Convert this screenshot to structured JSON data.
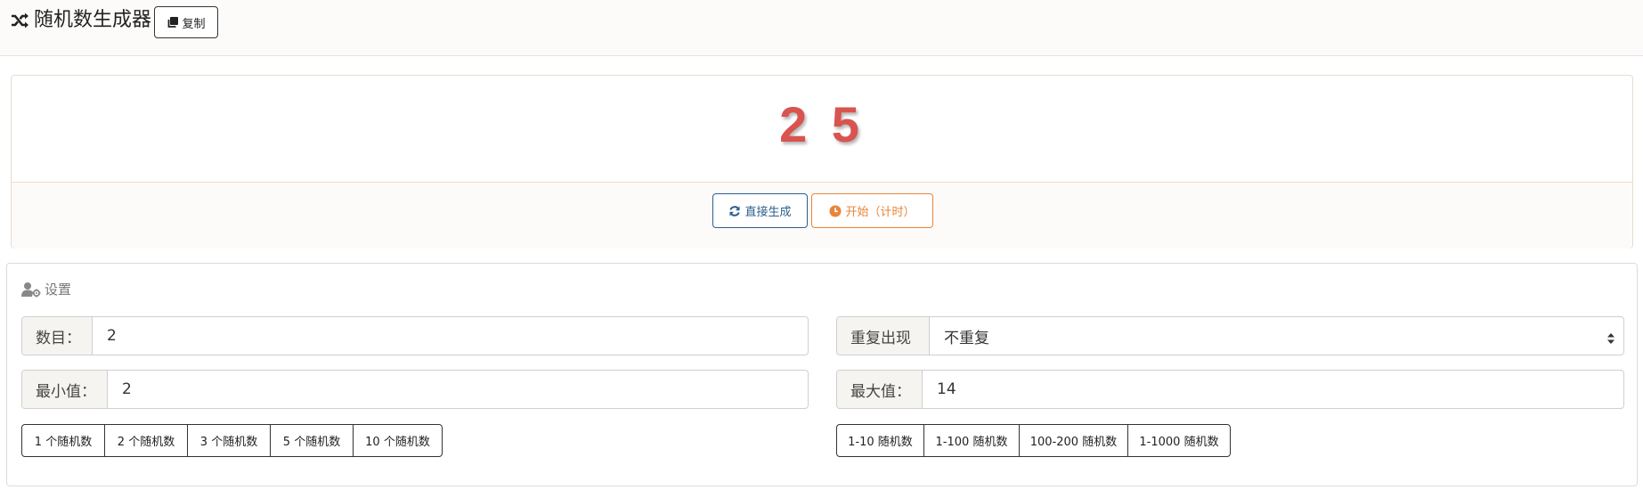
{
  "header": {
    "title": "随机数生成器",
    "copy_label": "复制"
  },
  "result": {
    "value": "2 5"
  },
  "actions": {
    "direct_label": "直接生成",
    "timed_label": "开始（计时）"
  },
  "settings": {
    "title": "设置",
    "count": {
      "label": "数目：",
      "value": "2"
    },
    "repeat": {
      "label": "重复出现",
      "value": "不重复"
    },
    "min": {
      "label": "最小值：",
      "value": "2"
    },
    "max": {
      "label": "最大值：",
      "value": "14"
    },
    "count_presets": [
      "1 个随机数",
      "2 个随机数",
      "3 个随机数",
      "5 个随机数",
      "10 个随机数"
    ],
    "range_presets": [
      "1-10 随机数",
      "1-100 随机数",
      "100-200 随机数",
      "1-1000 随机数"
    ]
  },
  "colors": {
    "result": "#d9534f",
    "primary": "#2e5e8e",
    "timed": "#e8843a"
  }
}
